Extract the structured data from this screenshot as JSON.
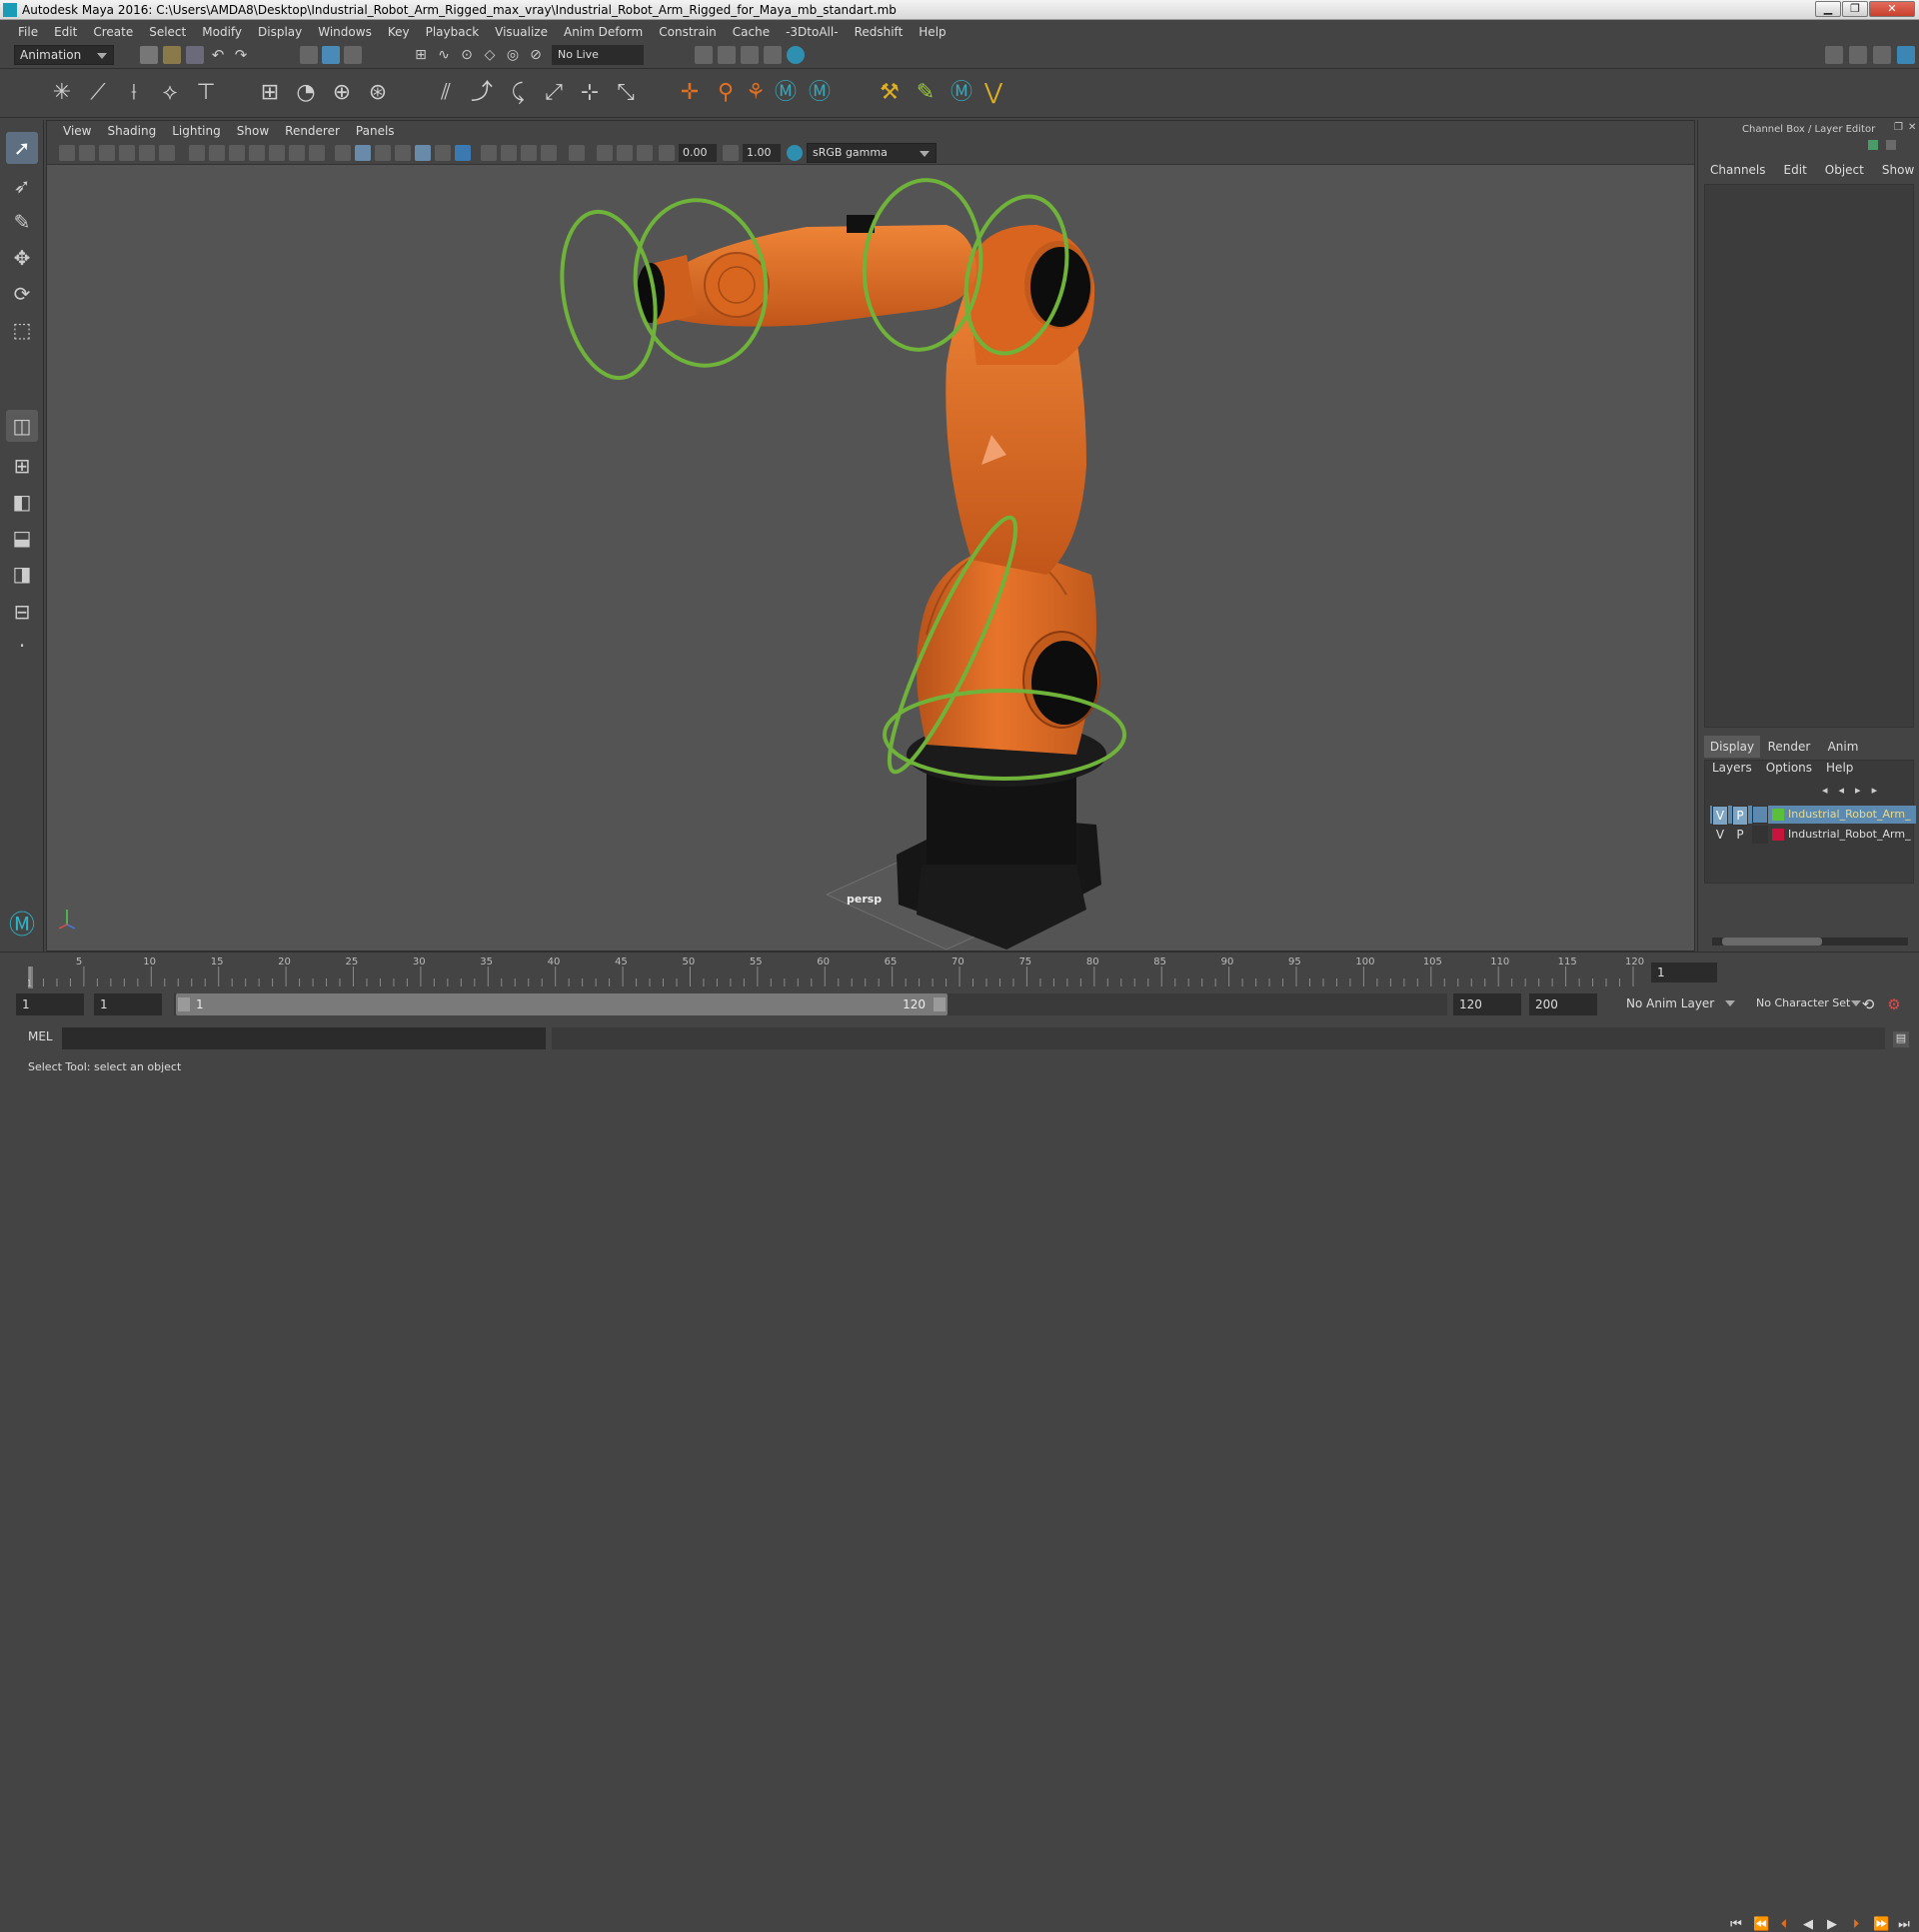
{
  "window": {
    "title": "Autodesk Maya 2016: C:\\Users\\AMDA8\\Desktop\\Industrial_Robot_Arm_Rigged_max_vray\\Industrial_Robot_Arm_Rigged_for_Maya_mb_standart.mb",
    "minimize": "▁",
    "maximize": "❐",
    "close": "✕"
  },
  "menubar": [
    "File",
    "Edit",
    "Create",
    "Select",
    "Modify",
    "Display",
    "Windows",
    "Key",
    "Playback",
    "Visualize",
    "Anim Deform",
    "Constrain",
    "Cache",
    "-3DtoAll-",
    "Redshift",
    "Help"
  ],
  "statusline": {
    "mode": "Animation",
    "live_surface": "No Live Surface"
  },
  "viewport": {
    "menu": [
      "View",
      "Shading",
      "Lighting",
      "Show",
      "Renderer",
      "Panels"
    ],
    "near_value": "0.00",
    "far_value": "1.00",
    "color_space": "sRGB gamma",
    "camera_label": "persp"
  },
  "channel_box": {
    "title": "Channel Box / Layer Editor",
    "menu": [
      "Channels",
      "Edit",
      "Object",
      "Show"
    ],
    "layer_tabs": [
      "Display",
      "Render",
      "Anim"
    ],
    "layer_menu": [
      "Layers",
      "Options",
      "Help"
    ],
    "layers": [
      {
        "v": "V",
        "p": "P",
        "name": "Industrial_Robot_Arm_",
        "color": "#5cbf3a",
        "selected": true
      },
      {
        "v": "V",
        "p": "P",
        "name": "Industrial_Robot_Arm_",
        "color": "#c8143c",
        "selected": false
      }
    ]
  },
  "timeline": {
    "ticks": [
      "1",
      "5",
      "10",
      "15",
      "20",
      "25",
      "30",
      "35",
      "40",
      "45",
      "50",
      "55",
      "60",
      "65",
      "70",
      "75",
      "80",
      "85",
      "90",
      "95",
      "100",
      "105",
      "110",
      "115",
      "120"
    ],
    "current_frame": "1"
  },
  "range": {
    "start": "1",
    "playback_start": "1",
    "slider_start": "1",
    "slider_end": "120",
    "playback_end": "120",
    "end": "200",
    "anim_layer": "No Anim Layer",
    "character_set": "No Character Set"
  },
  "command_line": {
    "label": "MEL"
  },
  "help_line": "Select Tool: select an object",
  "colors": {
    "robot_orange": "#e06a1e",
    "control_green": "#6fb33a",
    "base_black": "#141414",
    "maya_teal": "#1b9bb5"
  }
}
